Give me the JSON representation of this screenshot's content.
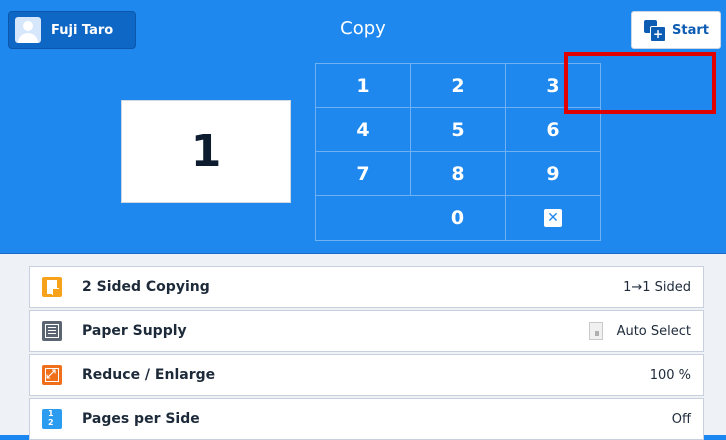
{
  "header": {
    "user_name": "Fuji Taro",
    "title": "Copy",
    "start_label": "Start"
  },
  "copies": {
    "count": "1"
  },
  "keypad": {
    "keys": [
      "1",
      "2",
      "3",
      "4",
      "5",
      "6",
      "7",
      "8",
      "9",
      "0"
    ],
    "clear_symbol": "✕"
  },
  "features": [
    {
      "label": "2 Sided Copying",
      "value": "1→1 Sided",
      "icon": "two-sided-icon"
    },
    {
      "label": "Paper Supply",
      "value": "Auto Select",
      "icon": "paper-supply-icon"
    },
    {
      "label": "Reduce / Enlarge",
      "value": "100 %",
      "icon": "reduce-enlarge-icon"
    },
    {
      "label": "Pages per Side",
      "value": "Off",
      "icon": "pages-per-side-icon"
    }
  ],
  "colors": {
    "accent": "#1e88ef",
    "highlight": "#e00000"
  }
}
